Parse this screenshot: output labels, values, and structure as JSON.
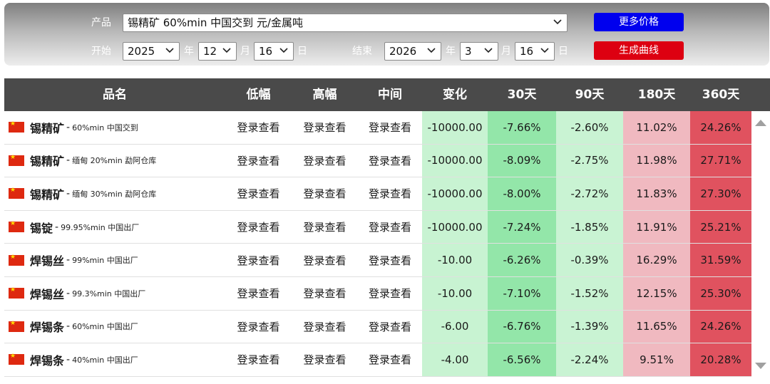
{
  "controls": {
    "product_label": "产品",
    "product_value": "锡精矿 60%min 中国交到 元/金属吨",
    "start_label": "开始",
    "end_label": "结束",
    "start": {
      "year": "2025",
      "month": "12",
      "day": "16"
    },
    "end": {
      "year": "2026",
      "month": "3",
      "day": "16"
    },
    "year_unit": "年",
    "month_unit": "月",
    "day_unit": "日",
    "more_prices_button": "更多价格",
    "generate_curve_button": "生成曲线",
    "more_prices_color": "#0000ee",
    "generate_curve_color": "#dd0011"
  },
  "table": {
    "headers": {
      "name": "品名",
      "low": "低幅",
      "high": "高幅",
      "mid": "中间",
      "change": "变化",
      "d30": "30天",
      "d90": "90天",
      "d180": "180天",
      "d360": "360天"
    },
    "login_text": "登录查看",
    "rows": [
      {
        "name": "锡精矿",
        "desc": "60%min 中国交到",
        "change": "-10000.00",
        "d30": "-7.66%",
        "d90": "-2.60%",
        "d180": "11.02%",
        "d360": "24.26%"
      },
      {
        "name": "锡精矿",
        "desc": "缅甸 20%min 勐阿仓库",
        "change": "-10000.00",
        "d30": "-8.09%",
        "d90": "-2.75%",
        "d180": "11.98%",
        "d360": "27.71%"
      },
      {
        "name": "锡精矿",
        "desc": "缅甸 30%min 勐阿仓库",
        "change": "-10000.00",
        "d30": "-8.00%",
        "d90": "-2.72%",
        "d180": "11.83%",
        "d360": "27.30%"
      },
      {
        "name": "锡锭",
        "desc": "99.95%min 中国出厂",
        "change": "-10000.00",
        "d30": "-7.24%",
        "d90": "-1.85%",
        "d180": "11.91%",
        "d360": "25.21%"
      },
      {
        "name": "焊锡丝",
        "desc": "99%min 中国出厂",
        "change": "-10.00",
        "d30": "-6.26%",
        "d90": "-0.39%",
        "d180": "16.29%",
        "d360": "31.59%"
      },
      {
        "name": "焊锡丝",
        "desc": "99.3%min 中国出厂",
        "change": "-10.00",
        "d30": "-7.10%",
        "d90": "-1.52%",
        "d180": "12.15%",
        "d360": "25.30%"
      },
      {
        "name": "焊锡条",
        "desc": "60%min 中国出厂",
        "change": "-6.00",
        "d30": "-6.76%",
        "d90": "-1.39%",
        "d180": "11.65%",
        "d360": "24.26%"
      },
      {
        "name": "焊锡条",
        "desc": "40%min 中国出厂",
        "change": "-4.00",
        "d30": "-6.56%",
        "d90": "-2.24%",
        "d180": "9.51%",
        "d360": "20.28%"
      }
    ]
  },
  "colors": {
    "header_bg": "#4a4a4a",
    "change_bg": "#c8f3d2",
    "d30_bg": "#93e6a9",
    "d90_bg": "#c9f3d3",
    "d180_bg": "#f0b9c0",
    "d360_bg": "#e0525f"
  }
}
